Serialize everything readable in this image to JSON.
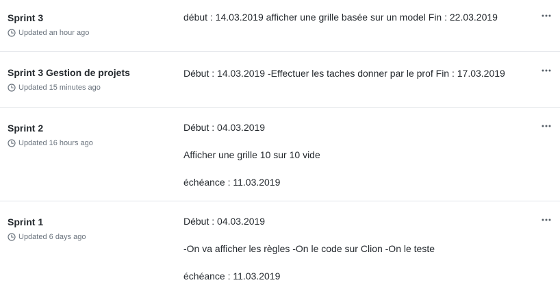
{
  "projects": [
    {
      "name": "Sprint 3",
      "updated": "Updated an hour ago",
      "description": [
        "début : 14.03.2019 afficher une grille basée sur un model Fin : 22.03.2019"
      ]
    },
    {
      "name": "Sprint 3 Gestion de projets",
      "updated": "Updated 15 minutes ago",
      "description": [
        "Début : 14.03.2019 -Effectuer les taches donner par le prof Fin : 17.03.2019"
      ]
    },
    {
      "name": "Sprint 2",
      "updated": "Updated 16 hours ago",
      "description": [
        "Début : 04.03.2019",
        "Afficher une grille 10 sur 10 vide",
        "échéance : 11.03.2019"
      ]
    },
    {
      "name": "Sprint 1",
      "updated": "Updated 6 days ago",
      "description": [
        "Début : 04.03.2019",
        "-On va afficher les règles -On le code sur Clion -On le teste",
        "échéance : 11.03.2019"
      ]
    }
  ],
  "icons": {
    "updated": "clock-icon",
    "menu": "kebab-horizontal-icon"
  },
  "colors": {
    "text": "#24292e",
    "muted": "#6a737d",
    "border": "#e1e4e8"
  }
}
